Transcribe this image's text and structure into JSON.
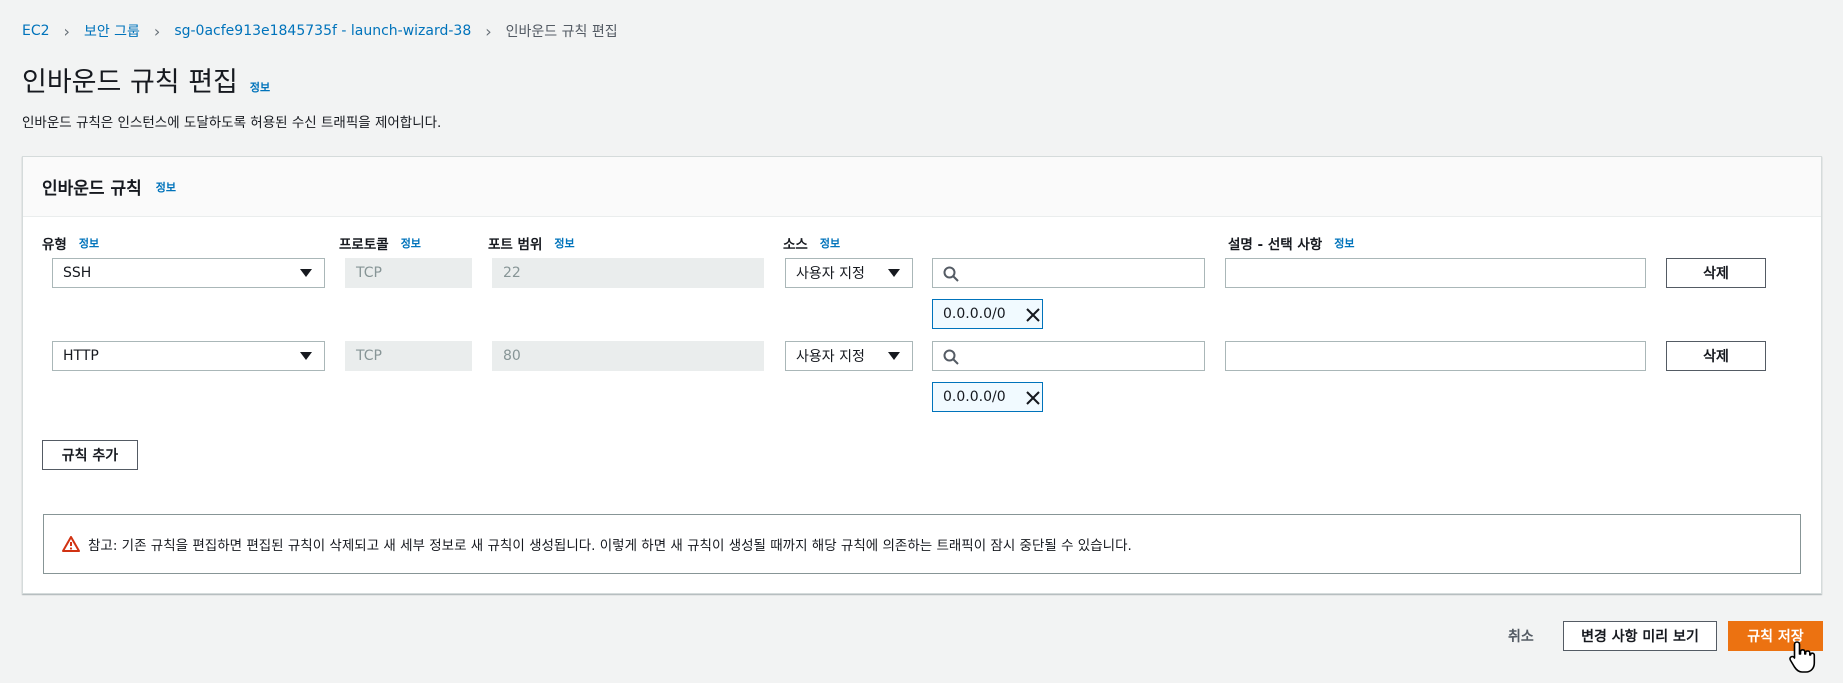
{
  "breadcrumb": [
    "EC2",
    "보안 그룹",
    "sg-0acfe913e1845735f - launch-wizard-38",
    "인바운드 규칙 편집"
  ],
  "page": {
    "title": "인바운드 규칙 편집",
    "info": "정보",
    "description": "인바운드 규칙은 인스턴스에 도달하도록 허용된 수신 트래픽을 제어합니다."
  },
  "panel": {
    "title": "인바운드 규칙",
    "info": "정보",
    "columns": {
      "type": "유형",
      "protocol": "프로토콜",
      "port": "포트 범위",
      "source": "소스",
      "description": "설명 - 선택 사항",
      "info": "정보"
    },
    "rules": [
      {
        "type": "SSH",
        "protocol": "TCP",
        "port": "22",
        "source": "사용자 지정",
        "cidr": "0.0.0.0/0",
        "delete": "삭제"
      },
      {
        "type": "HTTP",
        "protocol": "TCP",
        "port": "80",
        "source": "사용자 지정",
        "cidr": "0.0.0.0/0",
        "delete": "삭제"
      }
    ],
    "add_rule": "규칙 추가",
    "alert": "참고: 기존 규칙을 편집하면 편집된 규칙이 삭제되고 새 세부 정보로 새 규칙이 생성됩니다. 이렇게 하면 새 규칙이 생성될 때까지 해당 규칙에 의존하는 트래픽이 잠시 중단될 수 있습니다."
  },
  "footer": {
    "cancel": "취소",
    "preview": "변경 사항 미리 보기",
    "save": "규칙 저장"
  },
  "colors": {
    "link": "#0073bb",
    "primary": "#ec7211",
    "warning": "#d13212"
  }
}
